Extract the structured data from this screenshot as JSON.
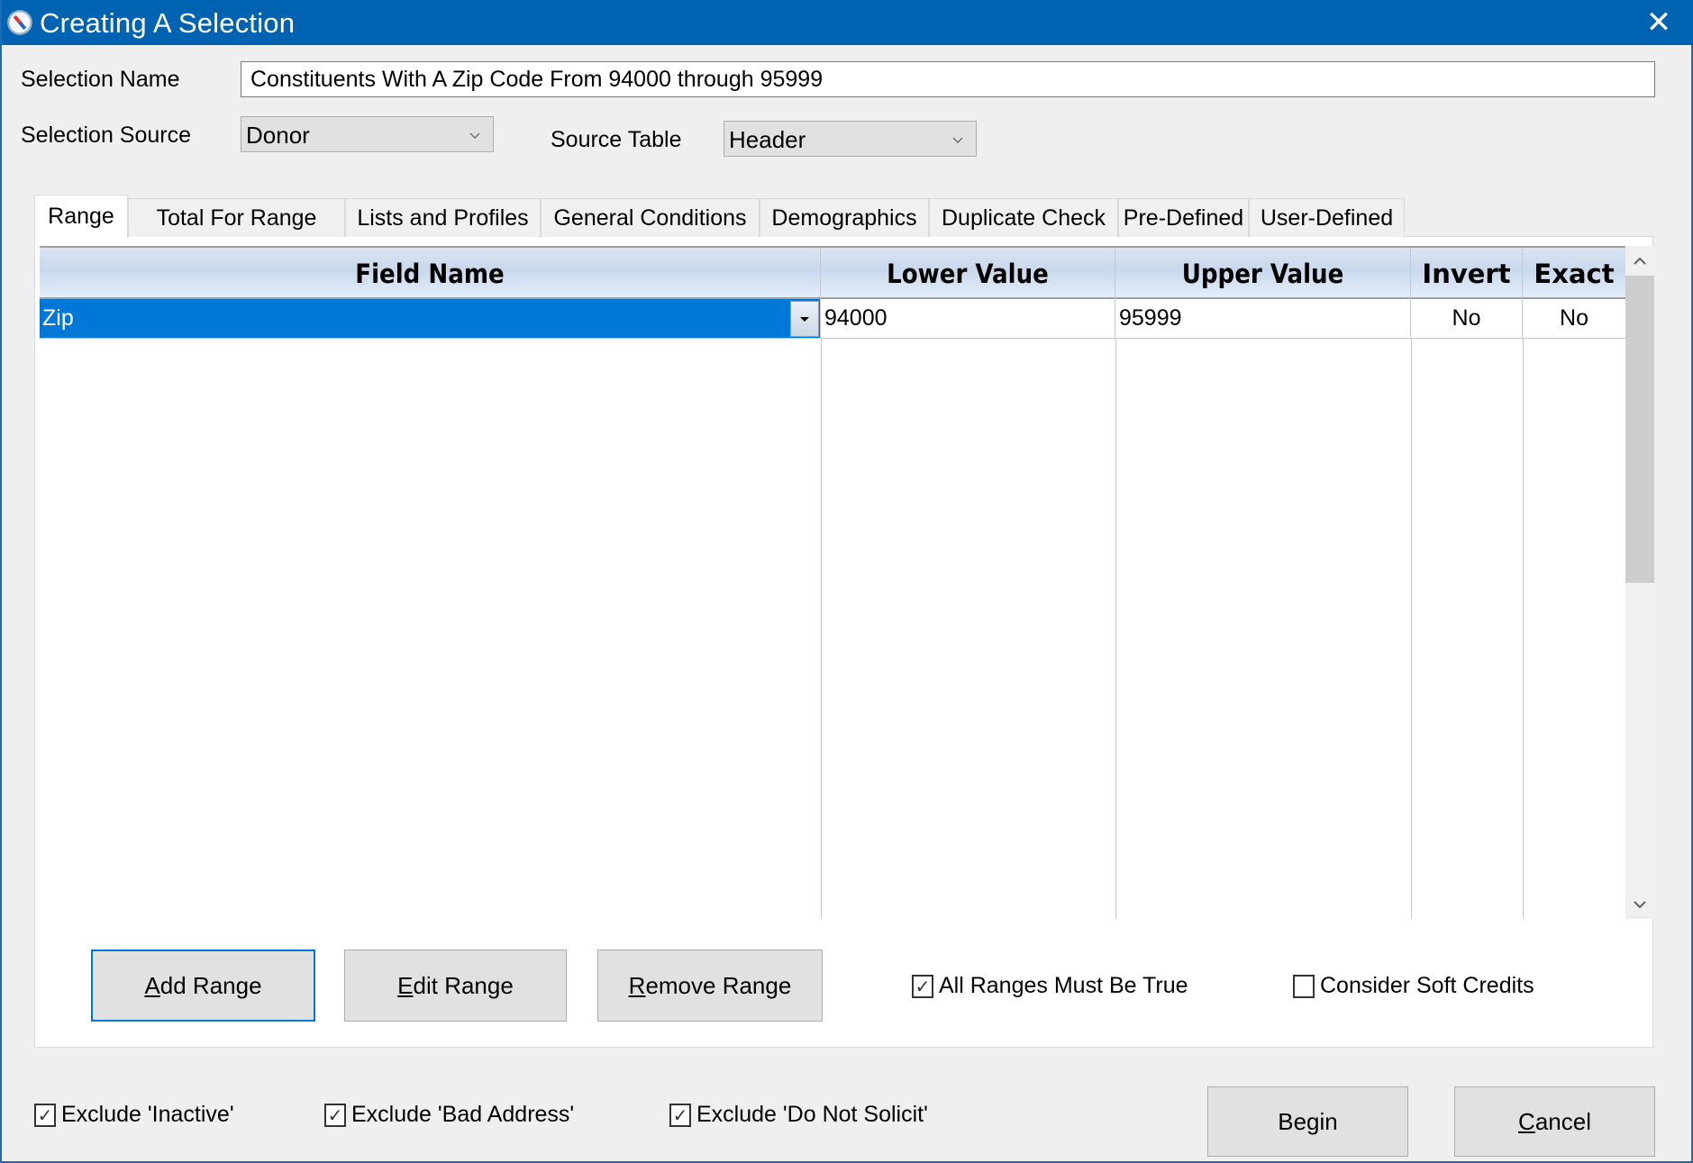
{
  "window": {
    "title": "Creating A Selection",
    "app_icon": "compass-icon",
    "close_icon": "close-icon",
    "close_glyph": "✕"
  },
  "form": {
    "selection_name_label": "Selection Name",
    "selection_name_value": "Constituents With A Zip Code From 94000 through 95999",
    "selection_source_label": "Selection Source",
    "selection_source_value": "Donor",
    "source_table_label": "Source Table",
    "source_table_value": "Header"
  },
  "tabs": [
    {
      "label": "Range",
      "active": true
    },
    {
      "label": "Total For Range",
      "active": false
    },
    {
      "label": "Lists and Profiles",
      "active": false
    },
    {
      "label": "General Conditions",
      "active": false
    },
    {
      "label": "Demographics",
      "active": false
    },
    {
      "label": "Duplicate Check",
      "active": false
    },
    {
      "label": "Pre-Defined",
      "active": false
    },
    {
      "label": "User-Defined",
      "active": false
    }
  ],
  "grid": {
    "columns": [
      "Field Name",
      "Lower Value",
      "Upper Value",
      "Invert",
      "Exact"
    ],
    "rows": [
      {
        "field_name": "Zip",
        "lower_value": "94000",
        "upper_value": "95999",
        "invert": "No",
        "exact": "No",
        "selected": true
      }
    ],
    "scroll_up_glyph": "⌃",
    "scroll_down_glyph": "⌄"
  },
  "range_buttons": {
    "add": {
      "mnemonic": "A",
      "rest": "dd Range"
    },
    "edit": {
      "mnemonic": "E",
      "rest": "dit Range"
    },
    "remove": {
      "mnemonic": "R",
      "rest": "emove Range"
    }
  },
  "range_options": {
    "all_ranges_must_be_true": {
      "label": "All Ranges Must Be True",
      "checked": true
    },
    "consider_soft_credits": {
      "label": "Consider Soft Credits",
      "checked": false
    }
  },
  "excludes": {
    "inactive": {
      "label": "Exclude 'Inactive'",
      "checked": true
    },
    "bad_address": {
      "label": "Exclude 'Bad Address'",
      "checked": true
    },
    "do_not_solicit": {
      "label": "Exclude 'Do Not Solicit'",
      "checked": true
    }
  },
  "footer": {
    "begin_label": "Begin",
    "cancel": {
      "mnemonic": "C",
      "rest": "ancel"
    }
  },
  "check_glyph": "✓",
  "colors": {
    "titlebar": "#0063b1",
    "selection": "#0078d7",
    "focus_border": "#0078d7"
  }
}
